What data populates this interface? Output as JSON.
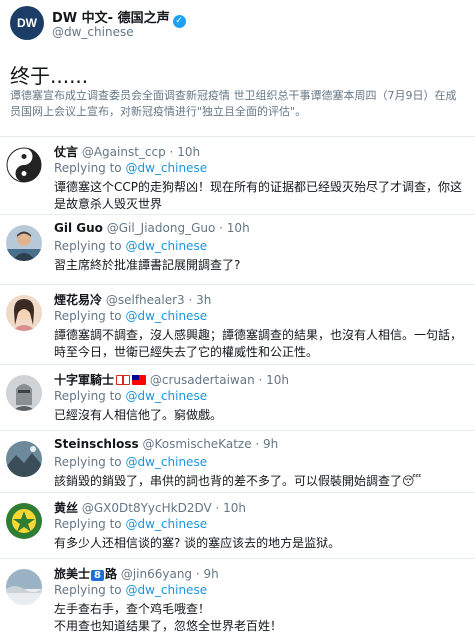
{
  "header": {
    "logo_text": "DW",
    "name": "DW 中文- 德国之声",
    "handle": "@dw_chinese"
  },
  "tweet": {
    "title": "终于......",
    "summary": "谭德塞宣布成立调查委员会全面调查新冠疫情 世卫组织总干事谭德塞本周四（7月9日）在成员国网上会议上宣布，对新冠疫情进行\"独立且全面的评估\"。"
  },
  "replying_label": "Replying to",
  "replying_mention": "@dw_chinese",
  "replies": [
    {
      "name": "仗言",
      "handle": "@Against_ccp",
      "time": "10h",
      "text": "谭德塞这个CCP的走狗帮凶！现在所有的证据都已经毁灭殆尽了才调查，你这是故意杀人毁灭世界"
    },
    {
      "name": "Gil Guo",
      "handle": "@Gil_Jiadong_Guo",
      "time": "10h",
      "text": "習主席終於批准譚書記展開調查了?"
    },
    {
      "name": "煙花易冷",
      "handle": "@selfhealer3",
      "time": "3h",
      "text": "譚德塞調不調查，沒人感興趣；譚德塞調查的結果，也沒有人相信。一句話，時至今日，世衛已經失去了它的權威性和公正性。"
    },
    {
      "name": "十字軍騎士",
      "handle": "@crusadertaiwan",
      "time": "10h",
      "text": "已經沒有人相信他了。窮做戲。"
    },
    {
      "name": "Steinschloss",
      "handle": "@KosmischeKatze",
      "time": "9h",
      "text": "該銷毀的銷毀了，串供的詞也背的差不多了。可以假裝開始調查了😴"
    },
    {
      "name": "黄丝",
      "handle": "@GX0Dt8YycHkD2DV",
      "time": "10h",
      "text": "有多少人还相信谈的塞? 谈的塞应该去的地方是监狱。"
    },
    {
      "name": "旅美士",
      "name_badge": "8",
      "name_suffix": "路",
      "handle": "@jin66yang",
      "time": "9h",
      "text_lines": [
        "左手查右手，查个鸡毛哦查！",
        "不用查也知道结果了，忽悠全世界老百姓！"
      ]
    }
  ],
  "colors": {
    "link": "#1b95e0",
    "secondary": "#657786",
    "divider": "#e6ecf0",
    "verified": "#1da1f2"
  }
}
